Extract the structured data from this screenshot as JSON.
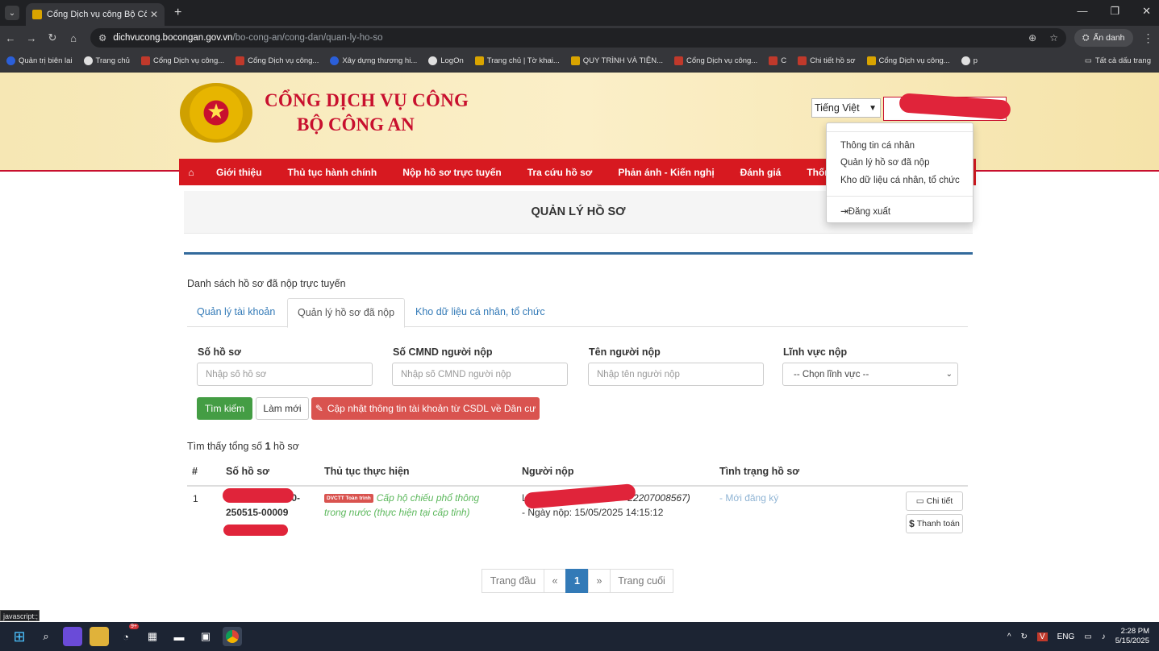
{
  "browser": {
    "tab_title": "Cổng Dịch vụ công Bộ Công an",
    "url_domain": "dichvucong.bocongan.gov.vn",
    "url_path": "/bo-cong-an/cong-dan/quan-ly-ho-so",
    "incognito_label": "Ẩn danh",
    "bookmarks": [
      "Quản trị biên lai",
      "Trang chủ",
      "Cổng Dịch vụ công...",
      "Cổng Dịch vụ công...",
      "Xây dựng thương hi...",
      "LogOn",
      "Trang chủ | Tờ khai...",
      "QUY TRÌNH VÀ TIỆN...",
      "Cổng Dịch vụ công...",
      "C",
      "Chi tiết hồ sơ",
      "Cổng Dịch vụ công...",
      "p"
    ],
    "all_bookmarks": "Tất cả dấu trang",
    "status_text": "javascript:;"
  },
  "header": {
    "brand_line1": "CỔNG DỊCH VỤ CÔNG",
    "brand_line2": "BỘ CÔNG AN",
    "language": "Tiếng Việt"
  },
  "nav": [
    "Giới thiệu",
    "Thủ tục hành chính",
    "Nộp hồ sơ trực tuyến",
    "Tra cứu hồ sơ",
    "Phản ánh - Kiến nghị",
    "Đánh giá",
    "Thống kê"
  ],
  "user_menu": {
    "items": [
      "Thông tin cá nhân",
      "Quản lý hồ sơ đã nộp",
      "Kho dữ liệu cá nhân, tổ chức"
    ],
    "logout": "Đăng xuất"
  },
  "page": {
    "title": "QUẢN LÝ HỒ SƠ",
    "list_title": "Danh sách hồ sơ đã nộp trực tuyến",
    "tabs": [
      "Quản lý tài khoản",
      "Quản lý hồ sơ đã nộp",
      "Kho dữ liệu cá nhân, tổ chức"
    ]
  },
  "filters": {
    "so_ho_so": {
      "label": "Số hồ sơ",
      "placeholder": "Nhập số hồ sơ"
    },
    "cmnd": {
      "label": "Số CMND người nộp",
      "placeholder": "Nhập số CMND người nộp"
    },
    "ten": {
      "label": "Tên người nộp",
      "placeholder": "Nhập tên người nộp"
    },
    "linh_vuc": {
      "label": "Lĩnh vực nộp",
      "selected": "-- Chọn lĩnh vực --"
    }
  },
  "buttons": {
    "search": "Tìm kiếm",
    "reset": "Làm mới",
    "update": "Cập nhật thông tin tài khoản từ CSDL về Dân cư"
  },
  "results": {
    "prefix": "Tìm thấy tổng số",
    "count": "1",
    "suffix": "hồ sơ"
  },
  "table": {
    "headers": [
      "#",
      "Số hồ sơ",
      "Thủ tục thực hiện",
      "Người nộp",
      "Tình trạng hồ sơ"
    ],
    "rows": [
      {
        "index": "1",
        "code_visible_end": "0-",
        "code_line2": "250515-00009",
        "badge": "DVCTT Toàn trình",
        "procedure": "Cấp hộ chiếu phổ thông trong nước (thực hiện tại cấp tỉnh)",
        "submitter_prefix": "Lê",
        "submitter_id": "22207008567)",
        "submit_date": "- Ngày nộp: 15/05/2025 14:15:12",
        "status": "- Mới đăng ký",
        "detail_btn": "Chi tiết",
        "pay_btn": "Thanh toán"
      }
    ]
  },
  "pagination": {
    "first": "Trang đầu",
    "prev": "«",
    "current": "1",
    "next": "»",
    "last": "Trang cuối"
  },
  "taskbar": {
    "lang": "ENG",
    "time": "2:28 PM",
    "date": "5/15/2025",
    "badge": "9+"
  },
  "colors": {
    "brand_red": "#d71920",
    "link_blue": "#337ab7",
    "success_green": "#449d44",
    "danger_red": "#d9534f"
  }
}
